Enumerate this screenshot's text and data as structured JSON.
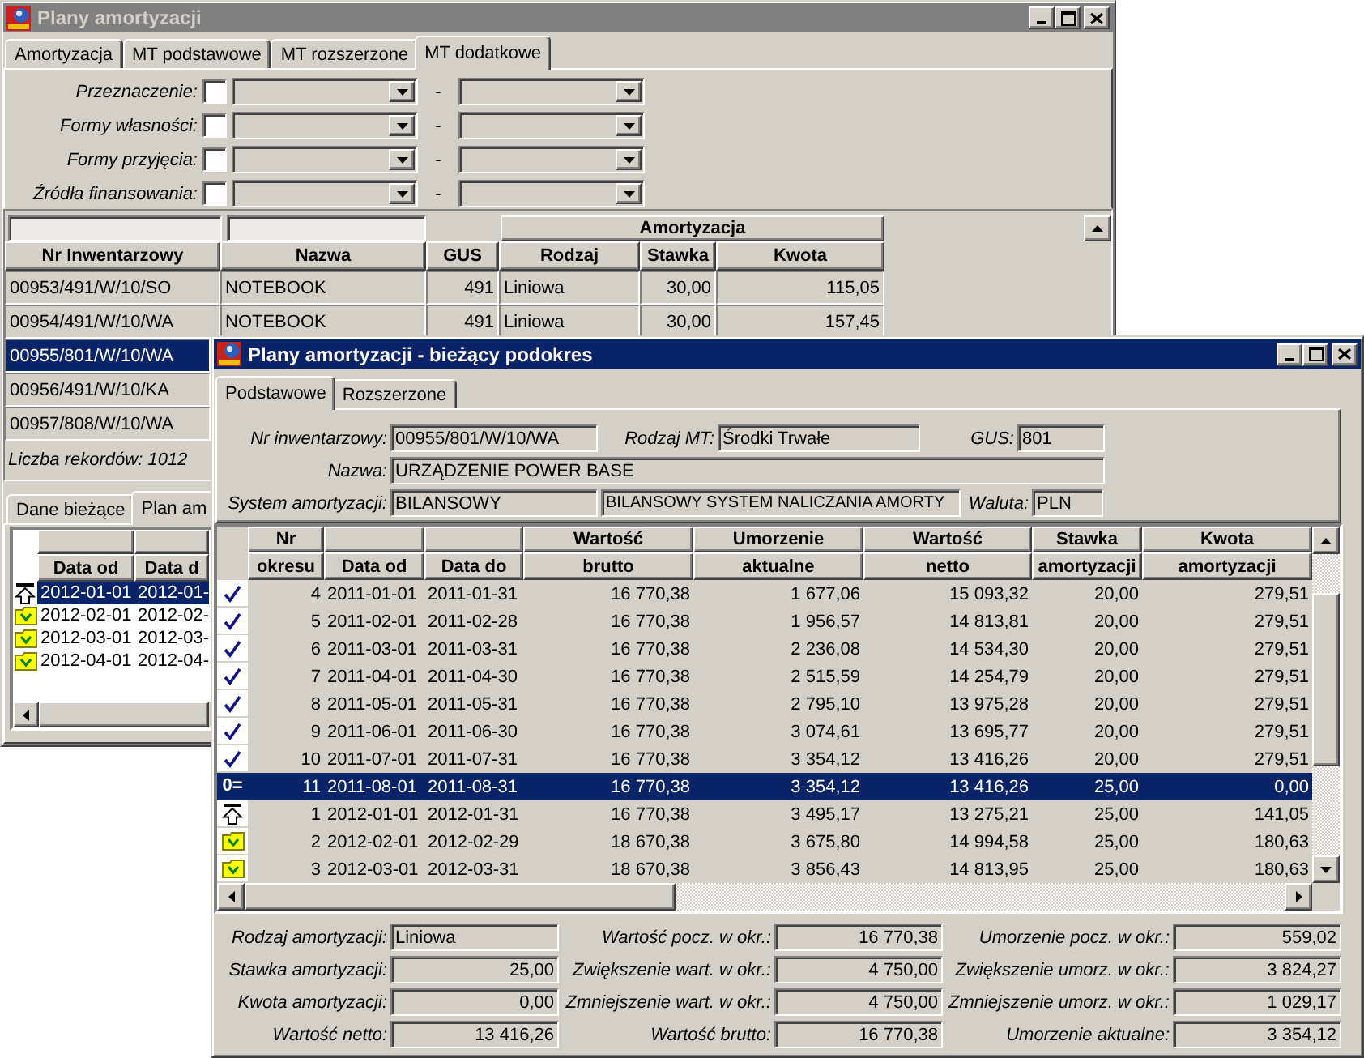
{
  "back_window": {
    "title": "Plany amortyzacji",
    "active": false,
    "tabs": [
      {
        "label": "Amortyzacja",
        "selected": false
      },
      {
        "label": "MT podstawowe",
        "selected": false
      },
      {
        "label": "MT rozszerzone",
        "selected": false
      },
      {
        "label": "MT dodatkowe",
        "selected": true
      }
    ],
    "filters": [
      {
        "label": "Przeznaczenie:",
        "checked": false,
        "separator": "-"
      },
      {
        "label": "Formy własności:",
        "checked": false,
        "separator": "-"
      },
      {
        "label": "Formy przyjęcia:",
        "checked": false,
        "separator": "-"
      },
      {
        "label": "Źródła finansowania:",
        "checked": false,
        "separator": "-"
      }
    ],
    "grid": {
      "group_header": "Amortyzacja",
      "columns": [
        "Nr Inwentarzowy",
        "Nazwa",
        "GUS",
        "Rodzaj",
        "Stawka",
        "Kwota"
      ],
      "rows": [
        {
          "cells": [
            "00953/491/W/10/SO",
            "NOTEBOOK",
            "491",
            "Liniowa",
            "30,00",
            "115,05"
          ],
          "selected": false
        },
        {
          "cells": [
            "00954/491/W/10/WA",
            "NOTEBOOK",
            "491",
            "Liniowa",
            "30,00",
            "157,45"
          ],
          "selected": false
        },
        {
          "cells": [
            "00955/801/W/10/WA"
          ],
          "selected": true
        },
        {
          "cells": [
            "00956/491/W/10/KA"
          ],
          "selected": false
        },
        {
          "cells": [
            "00957/808/W/10/WA"
          ],
          "selected": false
        }
      ],
      "record_count": "Liczba rekordów: 1012"
    },
    "detail_tabs": [
      {
        "label": "Dane bieżące",
        "selected": false
      },
      {
        "label": "Plan am",
        "selected": true
      }
    ],
    "detail_grid": {
      "columns": [
        "Data od",
        "Data d"
      ],
      "rows": [
        {
          "kind": "opening",
          "cells": [
            "2012-01-01",
            "2012-01-"
          ],
          "selected": true
        },
        {
          "kind": "planned",
          "cells": [
            "2012-02-01",
            "2012-02-"
          ],
          "selected": false
        },
        {
          "kind": "planned",
          "cells": [
            "2012-03-01",
            "2012-03-"
          ],
          "selected": false
        },
        {
          "kind": "planned",
          "cells": [
            "2012-04-01",
            "2012-04-"
          ],
          "selected": false
        }
      ]
    }
  },
  "front_window": {
    "title": "Plany amortyzacji - bieżący podokres",
    "active": true,
    "tabs": [
      {
        "label": "Podstawowe",
        "selected": true
      },
      {
        "label": "Rozszerzone",
        "selected": false
      }
    ],
    "info": {
      "inventory_no": {
        "label": "Nr inwentarzowy:",
        "value": "00955/801/W/10/WA"
      },
      "asset_type": {
        "label": "Rodzaj MT:",
        "value": "Środki Trwałe"
      },
      "gus": {
        "label": "GUS:",
        "value": "801"
      },
      "name": {
        "label": "Nazwa:",
        "value": "URZĄDZENIE POWER BASE"
      },
      "system": {
        "label": "System amortyzacji:",
        "code": "BILANSOWY",
        "description": "BILANSOWY SYSTEM NALICZANIA AMORTY"
      },
      "currency": {
        "label": "Waluta:",
        "value": "PLN"
      }
    },
    "table": {
      "columns": [
        {
          "top": "Nr",
          "bottom": "okresu"
        },
        {
          "bottom": "Data od"
        },
        {
          "bottom": "Data do"
        },
        {
          "top": "Wartość",
          "bottom": "brutto"
        },
        {
          "top": "Umorzenie",
          "bottom": "aktualne"
        },
        {
          "top": "Wartość",
          "bottom": "netto"
        },
        {
          "top": "Stawka",
          "bottom": "amortyzacji"
        },
        {
          "top": "Kwota",
          "bottom": "amortyzacji"
        }
      ],
      "rows": [
        {
          "kind": "closed",
          "selected": false,
          "cells": [
            "4",
            "2011-01-01",
            "2011-01-31",
            "16 770,38",
            "1 677,06",
            "15 093,32",
            "20,00",
            "279,51"
          ]
        },
        {
          "kind": "closed",
          "selected": false,
          "cells": [
            "5",
            "2011-02-01",
            "2011-02-28",
            "16 770,38",
            "1 956,57",
            "14 813,81",
            "20,00",
            "279,51"
          ]
        },
        {
          "kind": "closed",
          "selected": false,
          "cells": [
            "6",
            "2011-03-01",
            "2011-03-31",
            "16 770,38",
            "2 236,08",
            "14 534,30",
            "20,00",
            "279,51"
          ]
        },
        {
          "kind": "closed",
          "selected": false,
          "cells": [
            "7",
            "2011-04-01",
            "2011-04-30",
            "16 770,38",
            "2 515,59",
            "14 254,79",
            "20,00",
            "279,51"
          ]
        },
        {
          "kind": "closed",
          "selected": false,
          "cells": [
            "8",
            "2011-05-01",
            "2011-05-31",
            "16 770,38",
            "2 795,10",
            "13 975,28",
            "20,00",
            "279,51"
          ]
        },
        {
          "kind": "closed",
          "selected": false,
          "cells": [
            "9",
            "2011-06-01",
            "2011-06-30",
            "16 770,38",
            "3 074,61",
            "13 695,77",
            "20,00",
            "279,51"
          ]
        },
        {
          "kind": "closed",
          "selected": false,
          "cells": [
            "10",
            "2011-07-01",
            "2011-07-31",
            "16 770,38",
            "3 354,12",
            "13 416,26",
            "20,00",
            "279,51"
          ]
        },
        {
          "kind": "current",
          "marker": "0=",
          "selected": true,
          "cells": [
            "11",
            "2011-08-01",
            "2011-08-31",
            "16 770,38",
            "3 354,12",
            "13 416,26",
            "25,00",
            "0,00"
          ]
        },
        {
          "kind": "opening",
          "selected": false,
          "cells": [
            "1",
            "2012-01-01",
            "2012-01-31",
            "16 770,38",
            "3 495,17",
            "13 275,21",
            "25,00",
            "141,05"
          ]
        },
        {
          "kind": "planned",
          "selected": false,
          "cells": [
            "2",
            "2012-02-01",
            "2012-02-29",
            "18 670,38",
            "3 675,80",
            "14 994,58",
            "25,00",
            "180,63"
          ]
        },
        {
          "kind": "planned",
          "selected": false,
          "cells": [
            "3",
            "2012-03-01",
            "2012-03-31",
            "18 670,38",
            "3 856,43",
            "14 813,95",
            "25,00",
            "180,63"
          ]
        }
      ]
    },
    "summary": [
      {
        "label": "Rodzaj amortyzacji:",
        "value": "Liniowa",
        "kind": "text"
      },
      {
        "label": "Wartość pocz. w okr.:",
        "value": "16 770,38",
        "kind": "number"
      },
      {
        "label": "Umorzenie pocz. w okr.:",
        "value": "559,02",
        "kind": "number"
      },
      {
        "label": "Stawka amortyzacji:",
        "value": "25,00",
        "kind": "number"
      },
      {
        "label": "Zwiększenie wart. w okr.:",
        "value": "4 750,00",
        "kind": "number"
      },
      {
        "label": "Zwiększenie umorz. w okr.:",
        "value": "3 824,27",
        "kind": "number"
      },
      {
        "label": "Kwota amortyzacji:",
        "value": "0,00",
        "kind": "number"
      },
      {
        "label": "Zmniejszenie wart. w okr.:",
        "value": "4 750,00",
        "kind": "number"
      },
      {
        "label": "Zmniejszenie umorz. w okr.:",
        "value": "1 029,17",
        "kind": "number"
      },
      {
        "label": "Wartość netto:",
        "value": "13 416,26",
        "kind": "number"
      },
      {
        "label": "Wartość brutto:",
        "value": "16 770,38",
        "kind": "number"
      },
      {
        "label": "Umorzenie aktualne:",
        "value": "3 354,12",
        "kind": "number"
      }
    ]
  }
}
